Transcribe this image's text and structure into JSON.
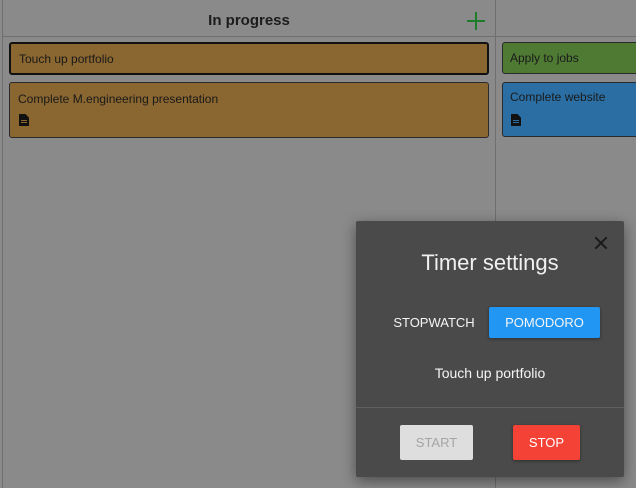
{
  "columns": [
    {
      "title": "In progress",
      "add_icon": "plus-icon",
      "cards": [
        {
          "title": "Touch up portfolio",
          "color": "#8a6630",
          "selected": true
        },
        {
          "title": "Complete M.engineering presentation",
          "color": "#8a6630",
          "icon": "document-icon"
        }
      ]
    },
    {
      "title": "",
      "cards": [
        {
          "title": "Apply to jobs",
          "color": "#4e7a33"
        },
        {
          "title": "Complete website",
          "color": "#2a6ea3",
          "icon": "document-icon"
        }
      ]
    }
  ],
  "dialog": {
    "title": "Timer settings",
    "close_icon": "close-icon",
    "modes": [
      "STOPWATCH",
      "POMODORO"
    ],
    "selected_mode": "POMODORO",
    "task_name": "Touch up portfolio",
    "start_label": "START",
    "start_enabled": false,
    "stop_label": "STOP",
    "colors": {
      "accent": "#2196f3",
      "stop": "#f44336",
      "dialog_bg": "#4a4a4a",
      "overlay": "#8a8a8a"
    }
  }
}
